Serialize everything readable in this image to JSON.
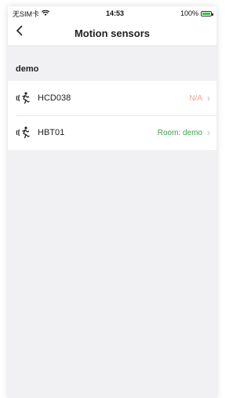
{
  "status": {
    "carrier": "无SIM卡",
    "time": "14:53",
    "battery": "100%"
  },
  "header": {
    "title": "Motion sensors",
    "back_icon": "chevron-left-icon"
  },
  "section": {
    "title": "demo"
  },
  "sensors": [
    {
      "name": "HCD038",
      "value": "N/A",
      "value_color": "#f2a19b"
    },
    {
      "name": "HBT01",
      "value": "Room: demo",
      "value_color": "#3aa54a"
    }
  ],
  "colors": {
    "background": "#f1f1f3",
    "surface": "#ffffff",
    "text": "#222222"
  }
}
